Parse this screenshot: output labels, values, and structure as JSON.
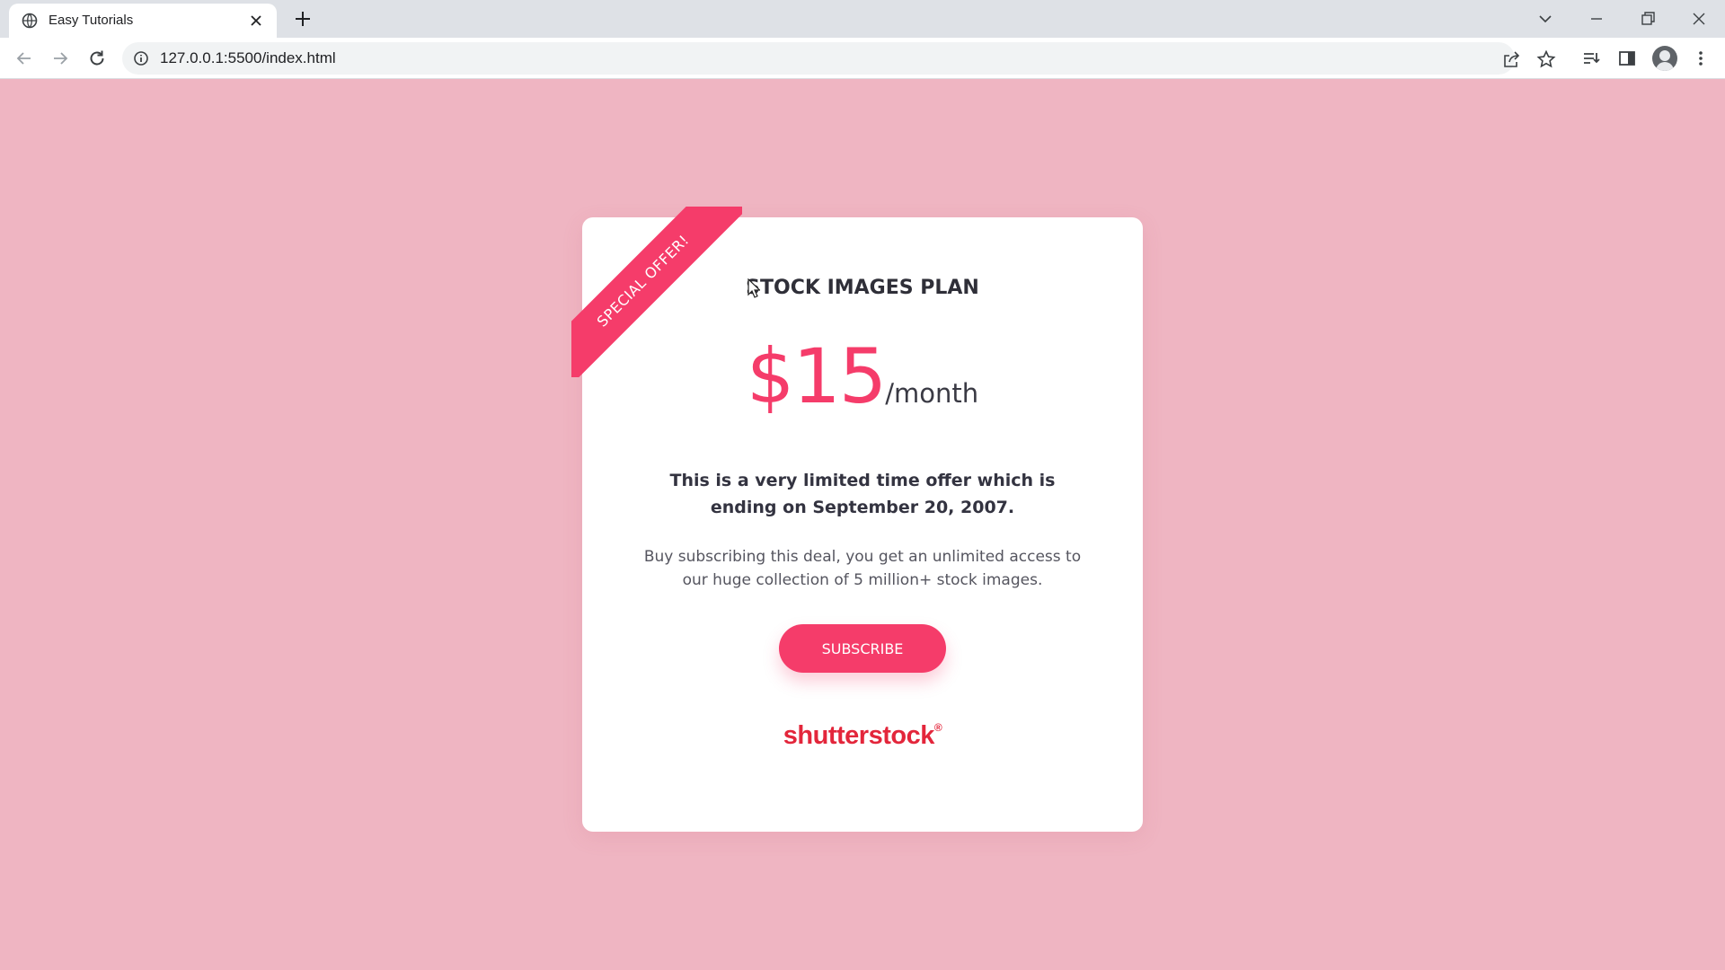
{
  "browser": {
    "tab_title": "Easy Tutorials",
    "url": "127.0.0.1:5500/index.html"
  },
  "icons": {
    "favicon": "globe-icon",
    "close": "close-icon",
    "new_tab": "plus-icon",
    "back": "arrow-left-icon",
    "forward": "arrow-right-icon",
    "reload": "reload-icon",
    "site_info": "info-icon",
    "share": "share-icon",
    "bookmark": "star-icon",
    "reading_list": "reading-list-icon",
    "side_panel": "side-panel-icon",
    "profile": "avatar",
    "menu": "kebab-menu-icon"
  },
  "card": {
    "ribbon": "SPECIAL OFFER!",
    "title": "STOCK IMAGES PLAN",
    "price": "$15",
    "period": "/month",
    "offer_text": "This is a very limited time offer which is ending on September 20, 2007.",
    "description": "Buy subscribing this deal, you get an unlimited access to our huge collection of 5 million+ stock images.",
    "button_label": "SUBSCRIBE",
    "logo_text": "shutterstock",
    "logo_mark": "®"
  },
  "colors": {
    "page_background": "#efb5c2",
    "accent": "#f53c6a",
    "logo": "#e3263b",
    "card": "#ffffff"
  }
}
